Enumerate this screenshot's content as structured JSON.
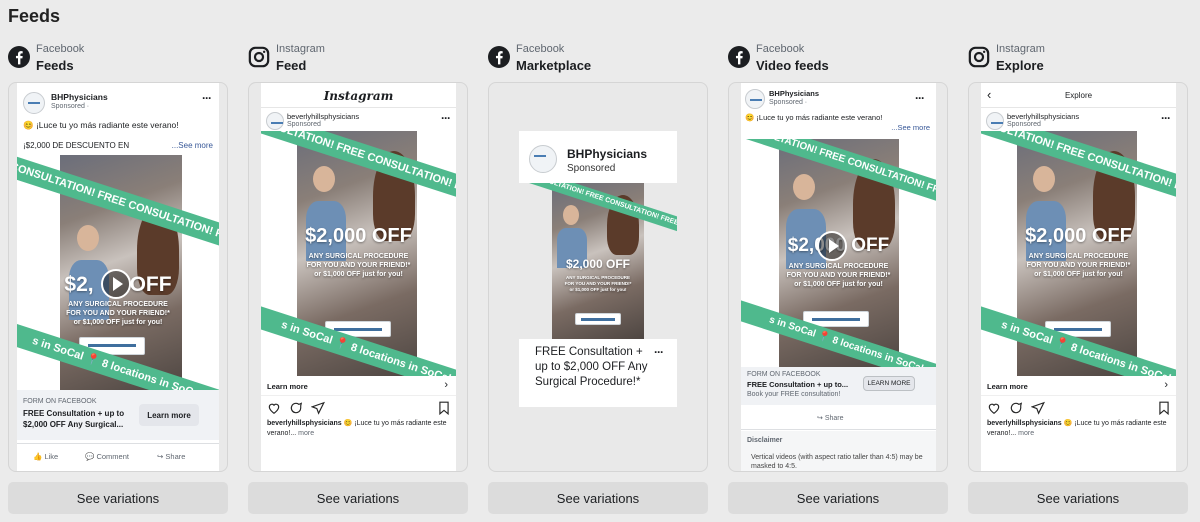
{
  "heading": "Feeds",
  "see_variations": "See variations",
  "brand": {
    "name": "BHPhysicians",
    "handle": "beverlyhillsphysicians",
    "sponsored": "Sponsored",
    "sponsored_dot": "Sponsored ·"
  },
  "ad": {
    "headline_es": "😊 ¡Luce tu yo más radiante este verano!",
    "discount_line": "¡$2,000 DE DESCUENTO EN",
    "see_more": "...See more",
    "banner_top": "CONSULTATION! FREE CONSULTATION! FREE",
    "banner_bottom": "s in SoCal 📍 8 locations in SoCal",
    "offer_big": "$2,000 OFF",
    "offer_line1": "ANY SURGICAL PROCEDURE",
    "offer_line2": "FOR YOU AND YOUR FRIEND!*",
    "offer_line3": "or $1,000 OFF just for you!",
    "offer_big_play_left": "$2,",
    "offer_big_play_right": "OFF",
    "form_label": "FORM ON FACEBOOK",
    "form_title": "FREE Consultation + up to $2,000 OFF Any Surgical...",
    "form_title_short": "FREE Consultation + up to...",
    "book_text": "Book your FREE consultation!",
    "learn_more": "Learn more",
    "learn_more_caps": "LEARN MORE",
    "marketplace_title": "FREE Consultation + up to $2,000 OFF Any Surgical Procedure!*",
    "ig_caption": "¡Luce tu yo más radiante este verano!...",
    "more": "more"
  },
  "fb_actions": {
    "like": "Like",
    "comment": "Comment",
    "share": "Share"
  },
  "video_feeds": {
    "share": "Share",
    "disclaimer_title": "Disclaimer",
    "disclaimer_text": "Vertical videos (with aspect ratio taller than 4:5) may be masked to 4:5."
  },
  "ig_header": {
    "logo_text": "Instagram",
    "explore_title": "Explore"
  },
  "placements": [
    {
      "platform": "Facebook",
      "placement": "Feeds",
      "icon": "facebook-icon"
    },
    {
      "platform": "Instagram",
      "placement": "Feed",
      "icon": "instagram-icon"
    },
    {
      "platform": "Facebook",
      "placement": "Marketplace",
      "icon": "facebook-icon"
    },
    {
      "platform": "Facebook",
      "placement": "Video feeds",
      "icon": "facebook-icon"
    },
    {
      "platform": "Instagram",
      "placement": "Explore",
      "icon": "instagram-icon"
    }
  ],
  "colors": {
    "background": "#ebebeb",
    "banner_green": "#4fb98d",
    "facebook_blue": "#1877f2",
    "see_more_blue": "#385898"
  }
}
